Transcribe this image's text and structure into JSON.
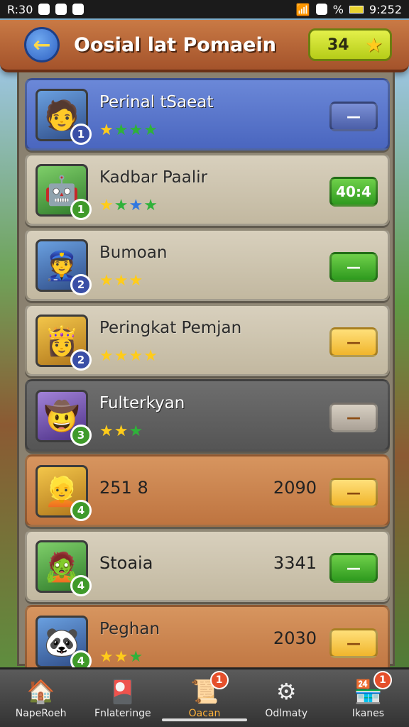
{
  "status_bar": {
    "time_left": "R:30",
    "time_right": "9:252",
    "battery_label": "%"
  },
  "header": {
    "title": "Oosial lat Pomaein",
    "score": "34",
    "back_icon": "arrow-left-icon",
    "score_icon": "star-icon"
  },
  "rows": [
    {
      "name": "Perinal tSaeat",
      "rank": "1",
      "stars": [
        "y",
        "g",
        "g",
        "g"
      ],
      "button_text": "—",
      "button_style": "blue"
    },
    {
      "name": "Kadbar Paalir",
      "rank": "1",
      "stars": [
        "y",
        "g",
        "b",
        "g"
      ],
      "button_text": "40:4",
      "button_style": "green"
    },
    {
      "name": "Bumoan",
      "rank": "2",
      "stars": [
        "y",
        "y",
        "y"
      ],
      "button_text": "—",
      "button_style": "green"
    },
    {
      "name": "Peringkat Pemjan",
      "rank": "2",
      "stars": [
        "y",
        "y",
        "y",
        "y"
      ],
      "button_text": "—",
      "button_style": "gold"
    },
    {
      "name": "Fulterkyan",
      "rank": "3",
      "stars": [
        "y",
        "y",
        "g"
      ],
      "button_text": "—",
      "button_style": "grey"
    },
    {
      "name": "251 8",
      "score": "2090",
      "rank": "4",
      "stars": [],
      "button_text": "—",
      "button_style": "gold"
    },
    {
      "name": "Stoaia",
      "score": "3341",
      "rank": "4",
      "stars": [],
      "button_text": "—",
      "button_style": "green"
    },
    {
      "name": "Peghan",
      "score": "2030",
      "rank": "4",
      "stars": [
        "y",
        "y",
        "g"
      ],
      "button_text": "—",
      "button_style": "gold"
    }
  ],
  "nav": [
    {
      "label": "NapeRoeh",
      "icon": "home-icon",
      "badge": ""
    },
    {
      "label": "Fnlateringe",
      "icon": "card-icon",
      "badge": ""
    },
    {
      "label": "Oacan",
      "icon": "quest-icon",
      "badge": "1",
      "active": true
    },
    {
      "label": "Odlmaty",
      "icon": "gear-icon",
      "badge": ""
    },
    {
      "label": "Ikanes",
      "icon": "shop-icon",
      "badge": "1"
    }
  ]
}
